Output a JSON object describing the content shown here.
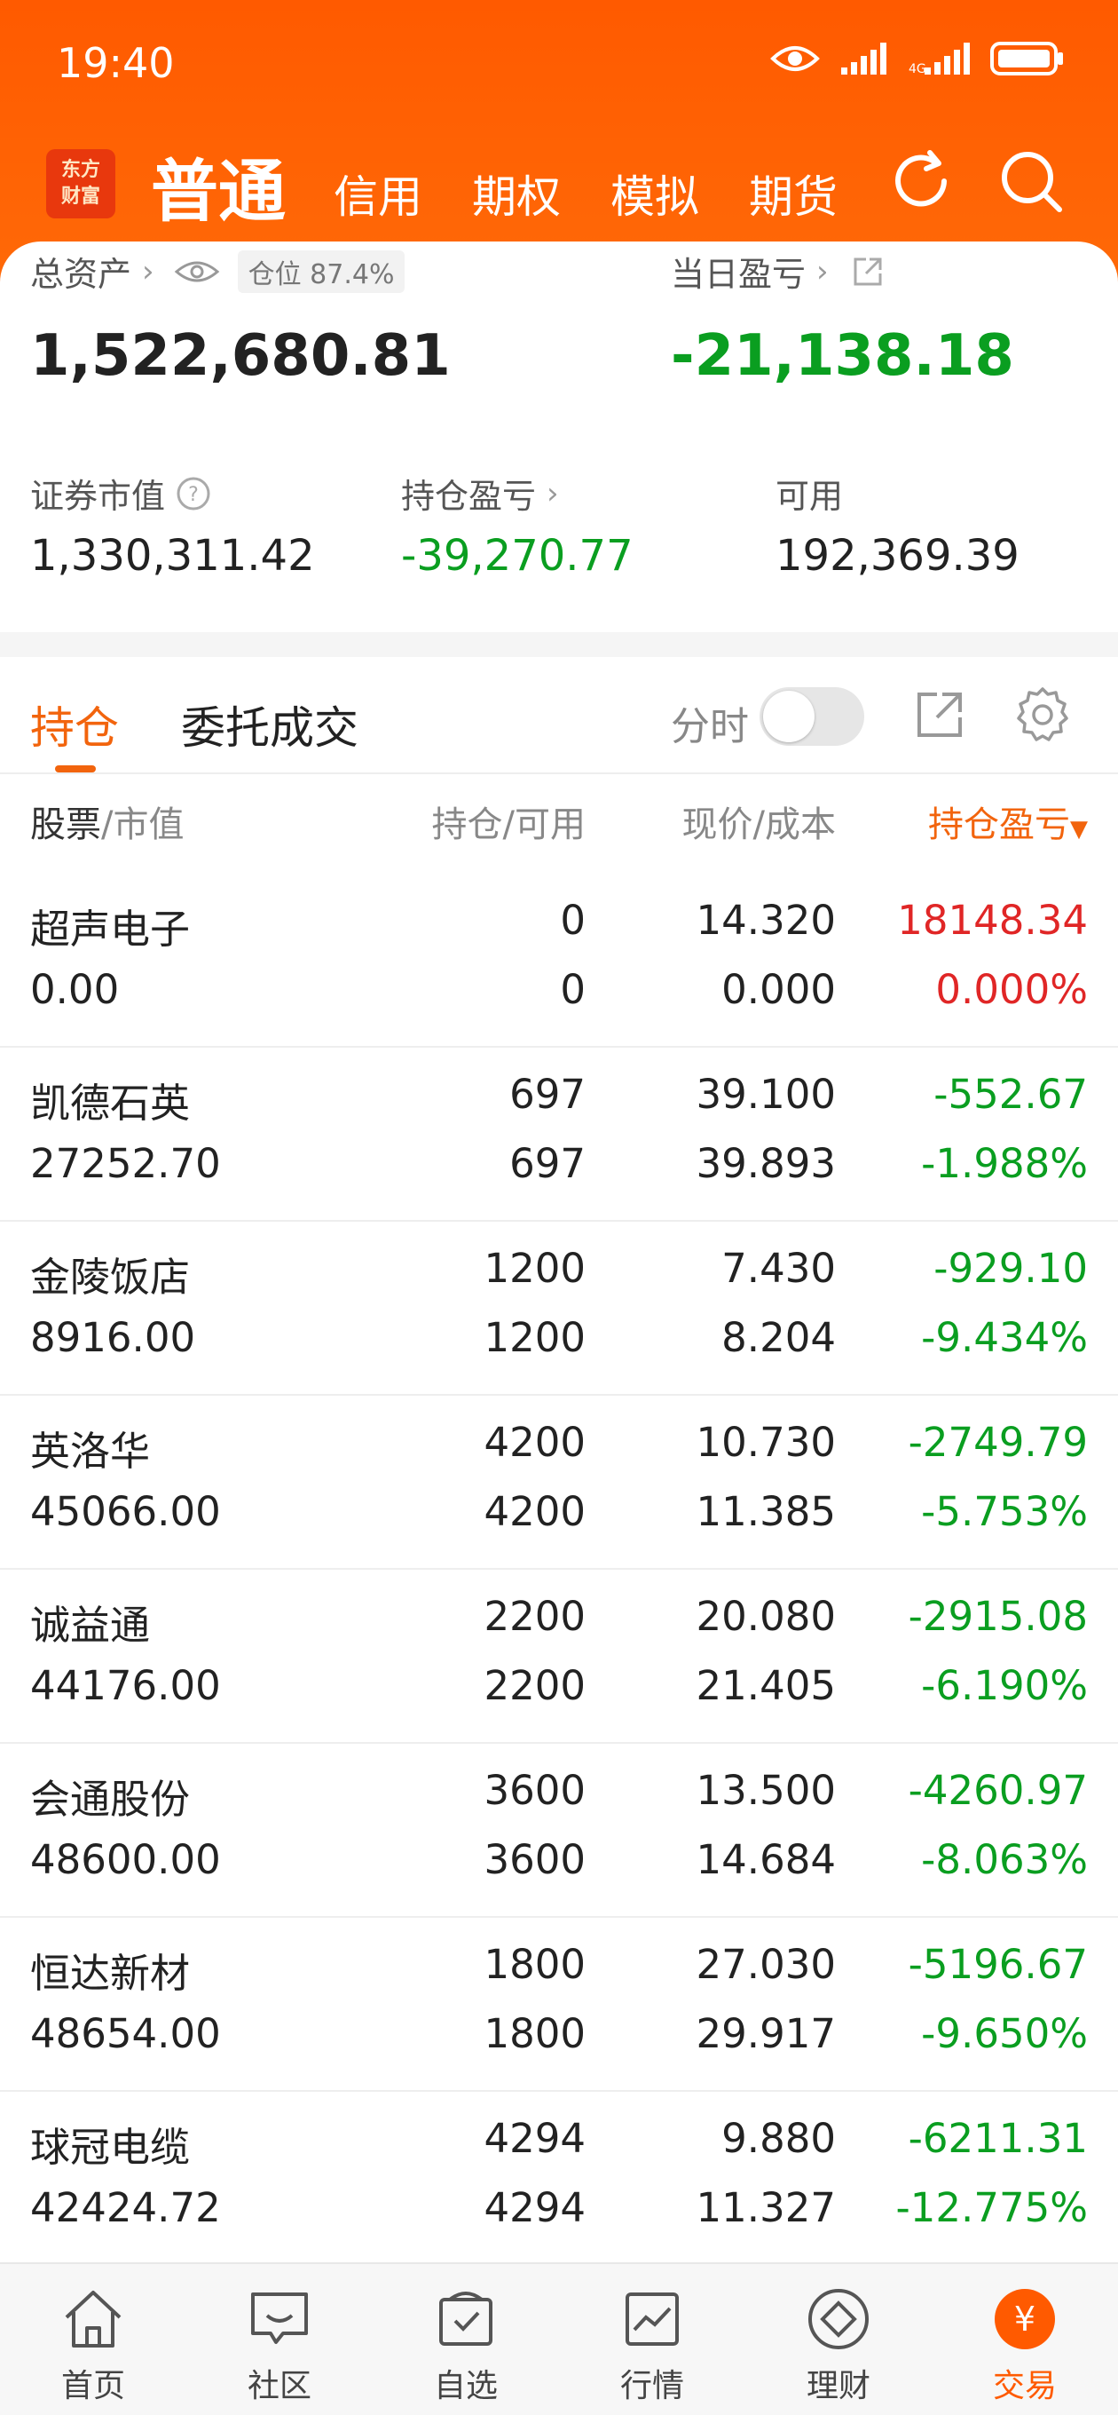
{
  "status_bar": {
    "time": "19:40"
  },
  "logo": {
    "line1": "东方",
    "line2": "财富"
  },
  "nav": {
    "active": "普通",
    "tabs": [
      "信用",
      "期权",
      "模拟",
      "期货"
    ]
  },
  "summary": {
    "total_assets_label": "总资产",
    "position_label": "仓位 87.4%",
    "total_assets": "1,522,680.81",
    "daily_pl_label": "当日盈亏",
    "daily_pl": "-21,138.18",
    "market_value_label": "证券市值",
    "market_value": "1,330,311.42",
    "holding_pl_label": "持仓盈亏",
    "holding_pl": "-39,270.77",
    "available_label": "可用",
    "available": "192,369.39"
  },
  "tabs": {
    "holdings": "持仓",
    "orders": "委托成交",
    "fenshi": "分时"
  },
  "table": {
    "headers": {
      "stock": "股票",
      "stock_sub": "/市值",
      "hold": "持仓/可用",
      "price": "现价/成本",
      "pl": "持仓盈亏"
    },
    "rows": [
      {
        "name": "超声电子",
        "value": "0.00",
        "hold": "0",
        "avail": "0",
        "price": "14.320",
        "cost": "0.000",
        "pl": "18148.34",
        "pct": "0.000%",
        "up": true
      },
      {
        "name": "凯德石英",
        "value": "27252.70",
        "hold": "697",
        "avail": "697",
        "price": "39.100",
        "cost": "39.893",
        "pl": "-552.67",
        "pct": "-1.988%",
        "up": false
      },
      {
        "name": "金陵饭店",
        "value": "8916.00",
        "hold": "1200",
        "avail": "1200",
        "price": "7.430",
        "cost": "8.204",
        "pl": "-929.10",
        "pct": "-9.434%",
        "up": false
      },
      {
        "name": "英洛华",
        "value": "45066.00",
        "hold": "4200",
        "avail": "4200",
        "price": "10.730",
        "cost": "11.385",
        "pl": "-2749.79",
        "pct": "-5.753%",
        "up": false
      },
      {
        "name": "诚益通",
        "value": "44176.00",
        "hold": "2200",
        "avail": "2200",
        "price": "20.080",
        "cost": "21.405",
        "pl": "-2915.08",
        "pct": "-6.190%",
        "up": false
      },
      {
        "name": "会通股份",
        "value": "48600.00",
        "hold": "3600",
        "avail": "3600",
        "price": "13.500",
        "cost": "14.684",
        "pl": "-4260.97",
        "pct": "-8.063%",
        "up": false
      },
      {
        "name": "恒达新材",
        "value": "48654.00",
        "hold": "1800",
        "avail": "1800",
        "price": "27.030",
        "cost": "29.917",
        "pl": "-5196.67",
        "pct": "-9.650%",
        "up": false
      },
      {
        "name": "球冠电缆",
        "value": "42424.72",
        "hold": "4294",
        "avail": "4294",
        "price": "9.880",
        "cost": "11.327",
        "pl": "-6211.31",
        "pct": "-12.775%",
        "up": false
      }
    ]
  },
  "bottom_nav": [
    {
      "label": "首页",
      "icon": "home-icon"
    },
    {
      "label": "社区",
      "icon": "community-icon"
    },
    {
      "label": "自选",
      "icon": "watchlist-icon"
    },
    {
      "label": "行情",
      "icon": "market-icon"
    },
    {
      "label": "理财",
      "icon": "wealth-icon"
    },
    {
      "label": "交易",
      "icon": "trade-icon",
      "active": true
    }
  ],
  "colors": {
    "brand": "#ff5a00",
    "up": "#e02626",
    "down": "#0a9e20",
    "accent": "#f2640d"
  }
}
